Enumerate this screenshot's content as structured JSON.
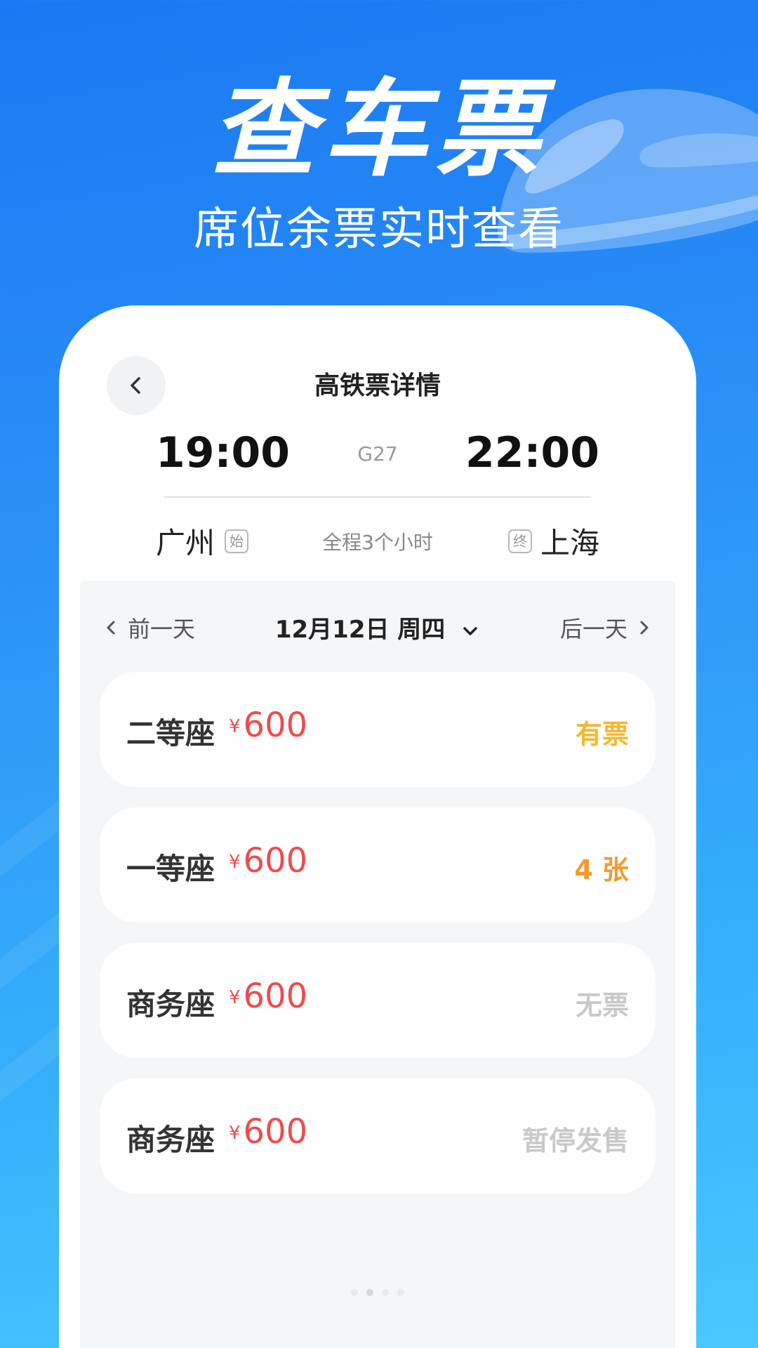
{
  "hero": {
    "title": "查车票",
    "subtitle": "席位余票实时查看"
  },
  "header": {
    "title": "高铁票详情",
    "back_icon": "chevron-left-icon"
  },
  "trip": {
    "departure_time": "19:00",
    "arrival_time": "22:00",
    "train_number": "G27",
    "departure_station": "广州",
    "departure_tag": "始",
    "arrival_station": "上海",
    "arrival_tag": "终",
    "duration": "全程3个小时"
  },
  "date_bar": {
    "prev_label": "前一天",
    "next_label": "后一天",
    "current_date": "12月12日 周四"
  },
  "seats": [
    {
      "name": "二等座",
      "currency": "¥",
      "price": "600",
      "status": "有票",
      "status_color": "#f5b82e"
    },
    {
      "name": "一等座",
      "currency": "¥",
      "price": "600",
      "status": "4 张",
      "status_color": "#f39a2b"
    },
    {
      "name": "商务座",
      "currency": "¥",
      "price": "600",
      "status": "无票",
      "status_color": "#c9c9c9"
    },
    {
      "name": "商务座",
      "currency": "¥",
      "price": "600",
      "status": "暂停发售",
      "status_color": "#c9c9c9"
    }
  ],
  "colors": {
    "background_top": "#1a78f2",
    "background_bottom": "#4ac8ff",
    "price": "#ef4b4b"
  }
}
